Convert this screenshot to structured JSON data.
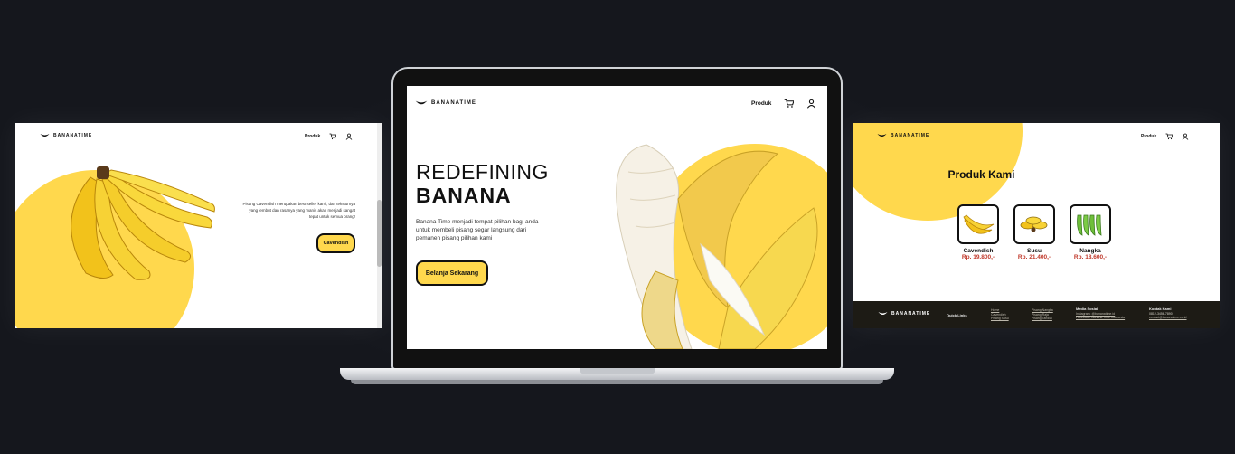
{
  "brand": "BANANATIME",
  "nav": {
    "product_label": "Produk"
  },
  "hero": {
    "title_line1": "REDEFINING",
    "title_line2": "BANANA",
    "description": "Banana Time menjadi tempat pilihan bagi anda untuk membeli pisang segar langsung dari pemanen pisang pilihan kami",
    "cta_label": "Belanja Sekarang"
  },
  "left_page": {
    "description": "Pisang Cavendish merupakan best seller kami, dari teksturnya yang lembut dan rasanya yang manis akan menjadi sangat tepat untuk semua orang!",
    "button_label": "Cavendish"
  },
  "right_page": {
    "section_title": "Produk Kami",
    "products": [
      {
        "name": "Cavendish",
        "price": "Rp. 19.800,-"
      },
      {
        "name": "Susu",
        "price": "Rp. 21.400,-"
      },
      {
        "name": "Nangka",
        "price": "Rp. 18.600,-"
      }
    ],
    "footer": {
      "brand": "BANANATIME",
      "quick_links_title": "Quick Links",
      "links_col1": [
        "Home",
        "Cavendish",
        "Pisang Susu"
      ],
      "links_col2": [
        "Pisang Nangka",
        "Pisang Raja",
        "Pisang Tanduk"
      ],
      "social_title": "Media Sosial",
      "social_lines": [
        "Instagram: @bananatime.id",
        "Facebook: Banana Time Indonesia"
      ],
      "contact_title": "Kontak Kami",
      "contact_lines": [
        "0812-3456-7890",
        "contact@bananatime.co.id"
      ]
    }
  },
  "colors": {
    "accent": "#ffd84d",
    "background": "#15171d",
    "price": "#c0392b",
    "footer": "#1d1b15"
  }
}
